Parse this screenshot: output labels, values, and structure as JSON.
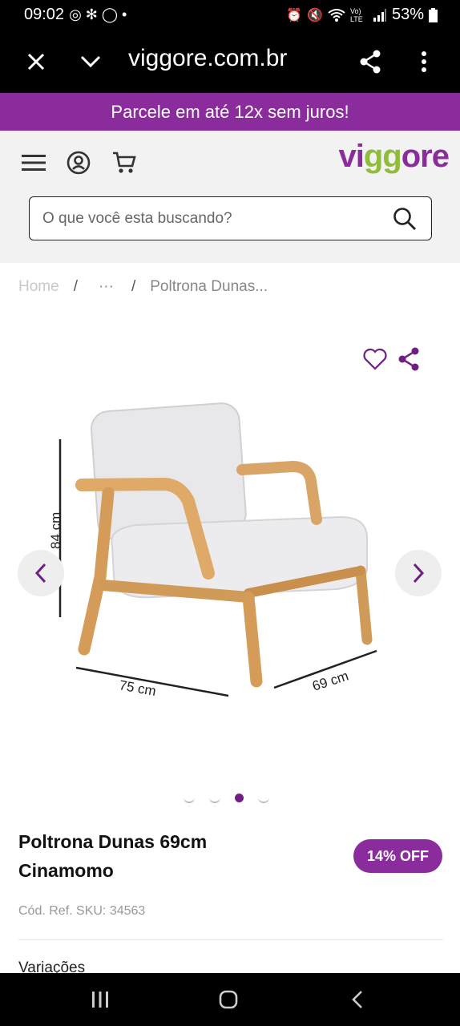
{
  "status_bar": {
    "time": "09:02",
    "battery": "53%",
    "network": "Vo) LTE"
  },
  "browser": {
    "url": "viggore.com.br"
  },
  "promo": {
    "text": "Parcele em até 12x sem juros!"
  },
  "header": {
    "logo": "viggore",
    "search_placeholder": "O que você esta buscando?"
  },
  "breadcrumb": {
    "home": "Home",
    "separator": "/",
    "ellipsis": "···",
    "current": "Poltrona Dunas..."
  },
  "product_image": {
    "dimension_height": "84 cm",
    "dimension_width": "75 cm",
    "dimension_depth": "69 cm",
    "carousel_count": 4,
    "carousel_active_index": 2
  },
  "product": {
    "title": "Poltrona Dunas 69cm Cinamomo",
    "discount": "14% OFF",
    "sku": "Cód. Ref. SKU: 34563",
    "variations_label": "Variações"
  },
  "colors": {
    "brand_purple": "#8a2c9c",
    "brand_green": "#8fbd3a"
  }
}
